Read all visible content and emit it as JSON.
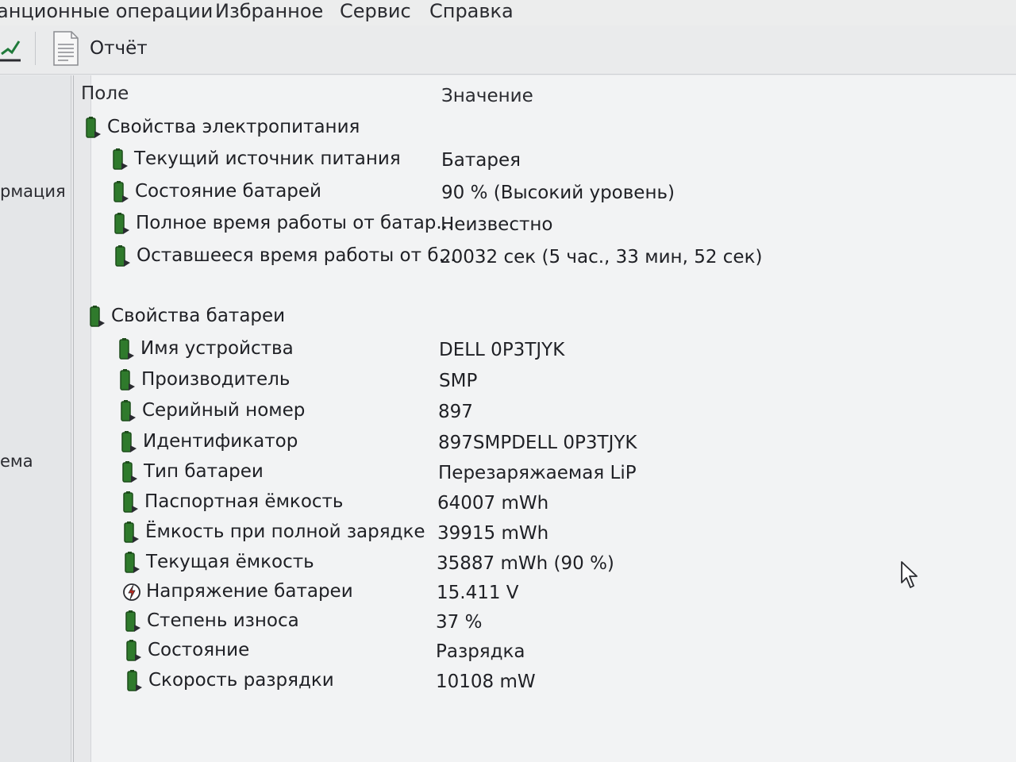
{
  "menu": {
    "items": [
      "анционные операции",
      "Избранное",
      "Сервис",
      "Справка"
    ]
  },
  "toolbar": {
    "report_label": "Отчёт"
  },
  "nav": {
    "items": [
      "рмация",
      "ема"
    ]
  },
  "table": {
    "col_field": "Поле",
    "col_value": "Значение"
  },
  "groups": [
    {
      "title": "Свойства электропитания",
      "rows": [
        {
          "field": "Текущий источник питания",
          "value": "Батарея",
          "icon": "battery-icon"
        },
        {
          "field": "Состояние батарей",
          "value": "90 % (Высокий уровень)",
          "icon": "battery-icon"
        },
        {
          "field": "Полное время работы от батар...",
          "value": "Неизвестно",
          "icon": "battery-icon"
        },
        {
          "field": "Оставшееся время работы от б...",
          "value": "20032 сек (5 час., 33 мин, 52 сек)",
          "icon": "battery-icon"
        }
      ]
    },
    {
      "title": "Свойства батареи",
      "rows": [
        {
          "field": "Имя устройства",
          "value": "DELL 0P3TJYK",
          "icon": "battery-icon"
        },
        {
          "field": "Производитель",
          "value": "SMP",
          "icon": "battery-icon"
        },
        {
          "field": "Серийный номер",
          "value": "897",
          "icon": "battery-icon"
        },
        {
          "field": "Идентификатор",
          "value": "897SMPDELL 0P3TJYK",
          "icon": "battery-icon"
        },
        {
          "field": "Тип батареи",
          "value": "Перезаряжаемая LiP",
          "icon": "battery-icon"
        },
        {
          "field": "Паспортная ёмкость",
          "value": "64007 mWh",
          "icon": "battery-icon"
        },
        {
          "field": "Ёмкость при полной зарядке",
          "value": "39915 mWh",
          "icon": "battery-icon"
        },
        {
          "field": "Текущая ёмкость",
          "value": "35887 mWh  (90 %)",
          "icon": "battery-icon"
        },
        {
          "field": "Напряжение батареи",
          "value": "15.411 V",
          "icon": "voltage-icon"
        },
        {
          "field": "Степень износа",
          "value": "37 %",
          "icon": "battery-icon"
        },
        {
          "field": "Состояние",
          "value": "Разрядка",
          "icon": "battery-icon"
        },
        {
          "field": "Скорость разрядки",
          "value": "10108 mW",
          "icon": "battery-icon"
        }
      ]
    }
  ],
  "colors": {
    "battery_green": "#2f7a2c",
    "battery_dark": "#1d4d1b",
    "voltage_red": "#c42a1e"
  }
}
